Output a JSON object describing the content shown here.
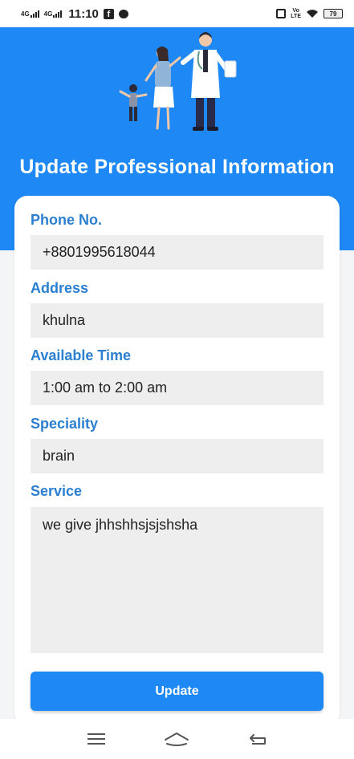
{
  "status_bar": {
    "network_1": "4G",
    "network_2": "4G",
    "time": "11:10",
    "volte": "Vo\nLTE",
    "battery": "79"
  },
  "header": {
    "title": "Update Professional Information"
  },
  "form": {
    "phone": {
      "label": "Phone No.",
      "value": "+8801995618044"
    },
    "address": {
      "label": "Address",
      "value": "khulna"
    },
    "available_time": {
      "label": "Available Time",
      "value": "1:00 am to 2:00 am"
    },
    "speciality": {
      "label": "Speciality",
      "value": "brain"
    },
    "service": {
      "label": "Service",
      "value": "we give jhhshhsjsjshsha"
    },
    "update_label": "Update"
  },
  "colors": {
    "primary": "#1e88f5",
    "label": "#2a7fd0",
    "input_bg": "#eeeeee"
  }
}
